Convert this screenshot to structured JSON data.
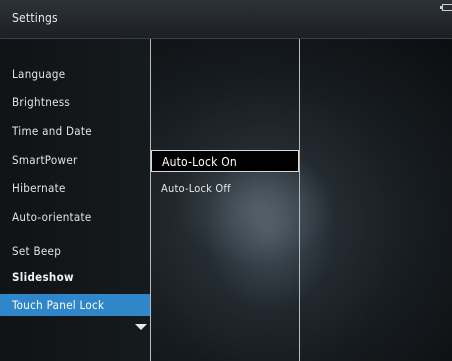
{
  "header": {
    "title": "Settings",
    "battery_icon": "battery-icon"
  },
  "menu": {
    "items": [
      {
        "label": "Language"
      },
      {
        "label": "Brightness"
      },
      {
        "label": "Time and Date"
      },
      {
        "label": "SmartPower"
      },
      {
        "label": "Hibernate"
      },
      {
        "label": "Auto-orientate"
      },
      {
        "label": "Set Beep"
      },
      {
        "label": "Slideshow"
      },
      {
        "label": "Touch Panel Lock"
      }
    ],
    "selected_index": 8,
    "scroll_icon": "chevron-down-icon"
  },
  "submenu": {
    "options": [
      {
        "label": "Auto-Lock On"
      },
      {
        "label": "Auto-Lock Off"
      }
    ],
    "focused_index": 0
  },
  "colors": {
    "selection": "#2f86c9",
    "text": "#e4e4e4",
    "background": "#0a0c0e"
  }
}
